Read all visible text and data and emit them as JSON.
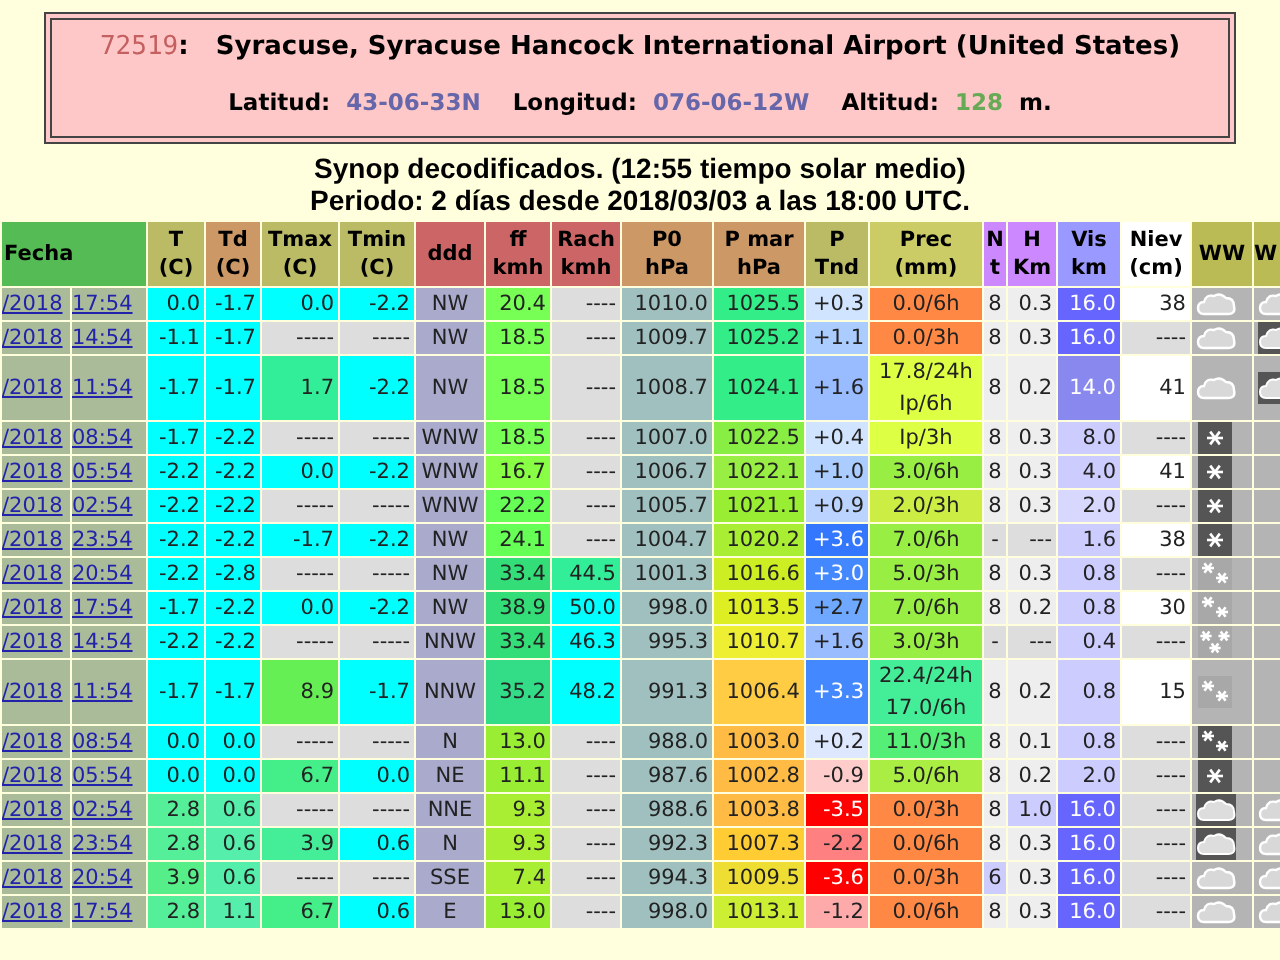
{
  "station": {
    "id": "72519",
    "separator": ":",
    "name": "Syracuse, Syracuse Hancock International Airport (United States)",
    "fields": [
      {
        "label": "Latitud:",
        "value": "43-06-33N",
        "color": "#6666aa"
      },
      {
        "label": "Longitud:",
        "value": "076-06-12W",
        "color": "#6666aa"
      },
      {
        "label": "Altitud:",
        "value": "128",
        "unit": "m.",
        "color": "#66aa55"
      }
    ]
  },
  "subtitle": "Synop decodificados. (12:55 tiempo solar medio)",
  "period": "Periodo: 2 días desde 2018/03/03 a las 18:00 UTC.",
  "columns": [
    {
      "label": "Fecha",
      "color": "#55bb55"
    },
    {
      "label": "T\n(C)",
      "color": "#bbbb66"
    },
    {
      "label": "Td\n(C)",
      "color": "#cc9966"
    },
    {
      "label": "Tmax\n(C)",
      "color": "#bbbb66"
    },
    {
      "label": "Tmin\n(C)",
      "color": "#bbbb66"
    },
    {
      "label": "ddd",
      "color": "#cc6666"
    },
    {
      "label": "ff\nkmh",
      "color": "#cc6666"
    },
    {
      "label": "Rach\nkmh",
      "color": "#cc6666"
    },
    {
      "label": "P0\nhPa",
      "color": "#cc9966"
    },
    {
      "label": "P mar\nhPa",
      "color": "#cc9966"
    },
    {
      "label": "P\nTnd",
      "color": "#bbbb66"
    },
    {
      "label": "Prec\n(mm)",
      "color": "#cccc66"
    },
    {
      "label": "N\nt",
      "color": "#cc88ff"
    },
    {
      "label": "H\nKm",
      "color": "#cc88ff"
    },
    {
      "label": "Vis\nkm",
      "color": "#9999ff"
    },
    {
      "label": "Niev\n(cm)",
      "color": "#ffffff"
    },
    {
      "label": "WW",
      "color": "#bbbb55"
    },
    {
      "label": "W",
      "color": "#bbbb55"
    }
  ],
  "rows": [
    {
      "date": "/2018",
      "time": "17:54",
      "ww": {
        "kind": "cloud"
      },
      "w": {
        "kind": "cloud"
      },
      "cells": [
        {
          "text": "0.0",
          "color": "#00ffff"
        },
        {
          "text": "-1.7",
          "color": "#00ffff"
        },
        {
          "text": "0.0",
          "color": "#00ffff"
        },
        {
          "text": "-2.2",
          "color": "#00ffff"
        },
        {
          "text": "NW",
          "color": "#aaaacc"
        },
        {
          "text": "20.4",
          "color": "#77ff55"
        },
        {
          "text": "----",
          "color": "#dddddd"
        },
        {
          "text": "1010.0",
          "color": "#a0c0c0"
        },
        {
          "text": "1025.5",
          "color": "#33ee88"
        },
        {
          "text": "+0.3",
          "color": "#d0e4ff"
        },
        {
          "text": "0.0/6h",
          "color": "#ff8844"
        },
        {
          "text": "8",
          "color": "#eeeeee"
        },
        {
          "text": "0.3",
          "color": "#eeeeee"
        },
        {
          "text": "16.0",
          "color": "#6666ff"
        },
        {
          "text": "38",
          "color": "#ffffff"
        }
      ]
    },
    {
      "date": "/2018",
      "time": "14:54",
      "ww": {
        "kind": "cloud"
      },
      "w": {
        "kind": "cloud_dark"
      },
      "cells": [
        {
          "text": "-1.1",
          "color": "#00ffff"
        },
        {
          "text": "-1.7",
          "color": "#00ffff"
        },
        {
          "text": "-----",
          "color": "#dddddd"
        },
        {
          "text": "-----",
          "color": "#dddddd"
        },
        {
          "text": "NW",
          "color": "#aaaacc"
        },
        {
          "text": "18.5",
          "color": "#77ff55"
        },
        {
          "text": "----",
          "color": "#dddddd"
        },
        {
          "text": "1009.7",
          "color": "#a0c0c0"
        },
        {
          "text": "1025.2",
          "color": "#33ee88"
        },
        {
          "text": "+1.1",
          "color": "#aaccff"
        },
        {
          "text": "0.0/3h",
          "color": "#ff8844"
        },
        {
          "text": "8",
          "color": "#eeeeee"
        },
        {
          "text": "0.3",
          "color": "#eeeeee"
        },
        {
          "text": "16.0",
          "color": "#6666ff"
        },
        {
          "text": "----",
          "color": "#dddddd"
        }
      ]
    },
    {
      "date": "/2018",
      "time": "11:54",
      "ww": {
        "kind": "cloud"
      },
      "w": {
        "kind": "cloud_dark"
      },
      "cells": [
        {
          "text": "-1.7",
          "color": "#00ffff"
        },
        {
          "text": "-1.7",
          "color": "#00ffff"
        },
        {
          "text": "1.7",
          "color": "#33ee99"
        },
        {
          "text": "-2.2",
          "color": "#00ffff"
        },
        {
          "text": "NW",
          "color": "#aaaacc"
        },
        {
          "text": "18.5",
          "color": "#77ff55"
        },
        {
          "text": "----",
          "color": "#dddddd"
        },
        {
          "text": "1008.7",
          "color": "#a0c0c0"
        },
        {
          "text": "1024.1",
          "color": "#33ee88"
        },
        {
          "text": "+1.6",
          "color": "#99bbff"
        },
        {
          "text": "17.8/24h\nIp/6h",
          "color": "#ddff44"
        },
        {
          "text": "8",
          "color": "#eeeeee"
        },
        {
          "text": "0.2",
          "color": "#eeeeee"
        },
        {
          "text": "14.0",
          "color": "#8888ee"
        },
        {
          "text": "41",
          "color": "#ffffff"
        }
      ]
    },
    {
      "date": "/2018",
      "time": "08:54",
      "ww": {
        "kind": "snow"
      },
      "cells": [
        {
          "text": "-1.7",
          "color": "#00ffff"
        },
        {
          "text": "-2.2",
          "color": "#00ffff"
        },
        {
          "text": "-----",
          "color": "#dddddd"
        },
        {
          "text": "-----",
          "color": "#dddddd"
        },
        {
          "text": "WNW",
          "color": "#aaaacc"
        },
        {
          "text": "18.5",
          "color": "#77ff55"
        },
        {
          "text": "----",
          "color": "#dddddd"
        },
        {
          "text": "1007.0",
          "color": "#a0c0c0"
        },
        {
          "text": "1022.5",
          "color": "#88ee44"
        },
        {
          "text": "+0.4",
          "color": "#d0e4ff"
        },
        {
          "text": "Ip/3h",
          "color": "#ddff44"
        },
        {
          "text": "8",
          "color": "#eeeeee"
        },
        {
          "text": "0.3",
          "color": "#eeeeee"
        },
        {
          "text": "8.0",
          "color": "#ccccff"
        },
        {
          "text": "----",
          "color": "#dddddd"
        }
      ]
    },
    {
      "date": "/2018",
      "time": "05:54",
      "ww": {
        "kind": "snow"
      },
      "cells": [
        {
          "text": "-2.2",
          "color": "#00ffff"
        },
        {
          "text": "-2.2",
          "color": "#00ffff"
        },
        {
          "text": "0.0",
          "color": "#00ffff"
        },
        {
          "text": "-2.2",
          "color": "#00ffff"
        },
        {
          "text": "WNW",
          "color": "#aaaacc"
        },
        {
          "text": "16.7",
          "color": "#88ff44"
        },
        {
          "text": "----",
          "color": "#dddddd"
        },
        {
          "text": "1006.7",
          "color": "#a0c0c0"
        },
        {
          "text": "1022.1",
          "color": "#99ee44"
        },
        {
          "text": "+1.0",
          "color": "#aaccff"
        },
        {
          "text": "3.0/6h",
          "color": "#99ee44"
        },
        {
          "text": "8",
          "color": "#eeeeee"
        },
        {
          "text": "0.3",
          "color": "#eeeeee"
        },
        {
          "text": "4.0",
          "color": "#ccccff"
        },
        {
          "text": "41",
          "color": "#ffffff"
        }
      ]
    },
    {
      "date": "/2018",
      "time": "02:54",
      "ww": {
        "kind": "snow"
      },
      "cells": [
        {
          "text": "-2.2",
          "color": "#00ffff"
        },
        {
          "text": "-2.2",
          "color": "#00ffff"
        },
        {
          "text": "-----",
          "color": "#dddddd"
        },
        {
          "text": "-----",
          "color": "#dddddd"
        },
        {
          "text": "WNW",
          "color": "#aaaacc"
        },
        {
          "text": "22.2",
          "color": "#66ff55"
        },
        {
          "text": "----",
          "color": "#dddddd"
        },
        {
          "text": "1005.7",
          "color": "#a0c0c0"
        },
        {
          "text": "1021.1",
          "color": "#99ee33"
        },
        {
          "text": "+0.9",
          "color": "#bbd4ff"
        },
        {
          "text": "2.0/3h",
          "color": "#ccee44"
        },
        {
          "text": "8",
          "color": "#eeeeee"
        },
        {
          "text": "0.3",
          "color": "#eeeeee"
        },
        {
          "text": "2.0",
          "color": "#d8d8ff"
        },
        {
          "text": "----",
          "color": "#dddddd"
        }
      ]
    },
    {
      "date": "/2018",
      "time": "23:54",
      "ww": {
        "kind": "snow"
      },
      "cells": [
        {
          "text": "-2.2",
          "color": "#00ffff"
        },
        {
          "text": "-2.2",
          "color": "#00ffff"
        },
        {
          "text": "-1.7",
          "color": "#00ffff"
        },
        {
          "text": "-2.2",
          "color": "#00ffff"
        },
        {
          "text": "NW",
          "color": "#aaaacc"
        },
        {
          "text": "24.1",
          "color": "#66ff55"
        },
        {
          "text": "----",
          "color": "#dddddd"
        },
        {
          "text": "1004.7",
          "color": "#a0c0c0"
        },
        {
          "text": "1020.2",
          "color": "#aaee33"
        },
        {
          "text": "+3.6",
          "color": "#3377ff"
        },
        {
          "text": "7.0/6h",
          "color": "#99ee44"
        },
        {
          "text": "-",
          "color": "#dddddd"
        },
        {
          "text": "---",
          "color": "#dddddd"
        },
        {
          "text": "1.6",
          "color": "#ccccff"
        },
        {
          "text": "38",
          "color": "#ffffff"
        }
      ]
    },
    {
      "date": "/2018",
      "time": "20:54",
      "ww": {
        "kind": "snow_pair"
      },
      "cells": [
        {
          "text": "-2.2",
          "color": "#00ffff"
        },
        {
          "text": "-2.8",
          "color": "#00ffff"
        },
        {
          "text": "-----",
          "color": "#dddddd"
        },
        {
          "text": "-----",
          "color": "#dddddd"
        },
        {
          "text": "NW",
          "color": "#aaaacc"
        },
        {
          "text": "33.4",
          "color": "#33dd77"
        },
        {
          "text": "44.5",
          "color": "#33ee99"
        },
        {
          "text": "1001.3",
          "color": "#a0c0c0"
        },
        {
          "text": "1016.6",
          "color": "#ccee22"
        },
        {
          "text": "+3.0",
          "color": "#4488ff"
        },
        {
          "text": "5.0/3h",
          "color": "#99ee44"
        },
        {
          "text": "8",
          "color": "#eeeeee"
        },
        {
          "text": "0.3",
          "color": "#eeeeee"
        },
        {
          "text": "0.8",
          "color": "#ccccff"
        },
        {
          "text": "----",
          "color": "#dddddd"
        }
      ]
    },
    {
      "date": "/2018",
      "time": "17:54",
      "ww": {
        "kind": "snow_pair"
      },
      "cells": [
        {
          "text": "-1.7",
          "color": "#00ffff"
        },
        {
          "text": "-2.2",
          "color": "#00ffff"
        },
        {
          "text": "0.0",
          "color": "#00ffff"
        },
        {
          "text": "-2.2",
          "color": "#00ffff"
        },
        {
          "text": "NW",
          "color": "#aaaacc"
        },
        {
          "text": "38.9",
          "color": "#33dd77"
        },
        {
          "text": "50.0",
          "color": "#00ffff"
        },
        {
          "text": "998.0",
          "color": "#a0c0c0"
        },
        {
          "text": "1013.5",
          "color": "#ddee22"
        },
        {
          "text": "+2.7",
          "color": "#6fa8ff"
        },
        {
          "text": "7.0/6h",
          "color": "#99ee44"
        },
        {
          "text": "8",
          "color": "#eeeeee"
        },
        {
          "text": "0.2",
          "color": "#eeeeee"
        },
        {
          "text": "0.8",
          "color": "#ccccff"
        },
        {
          "text": "30",
          "color": "#ffffff"
        }
      ]
    },
    {
      "date": "/2018",
      "time": "14:54",
      "ww": {
        "kind": "snow_three"
      },
      "cells": [
        {
          "text": "-2.2",
          "color": "#00ffff"
        },
        {
          "text": "-2.2",
          "color": "#00ffff"
        },
        {
          "text": "-----",
          "color": "#dddddd"
        },
        {
          "text": "-----",
          "color": "#dddddd"
        },
        {
          "text": "NNW",
          "color": "#aaaacc"
        },
        {
          "text": "33.4",
          "color": "#33dd77"
        },
        {
          "text": "46.3",
          "color": "#00ffff"
        },
        {
          "text": "995.3",
          "color": "#a0c0c0"
        },
        {
          "text": "1010.7",
          "color": "#eeee33"
        },
        {
          "text": "+1.6",
          "color": "#99bbff"
        },
        {
          "text": "3.0/3h",
          "color": "#99ee44"
        },
        {
          "text": "-",
          "color": "#dddddd"
        },
        {
          "text": "---",
          "color": "#dddddd"
        },
        {
          "text": "0.4",
          "color": "#ccccff"
        },
        {
          "text": "----",
          "color": "#dddddd"
        }
      ]
    },
    {
      "date": "/2018",
      "time": "11:54",
      "ww": {
        "kind": "snow_pair"
      },
      "cells": [
        {
          "text": "-1.7",
          "color": "#00ffff"
        },
        {
          "text": "-1.7",
          "color": "#00ffff"
        },
        {
          "text": "8.9",
          "color": "#66ee55"
        },
        {
          "text": "-1.7",
          "color": "#00ffff"
        },
        {
          "text": "NNW",
          "color": "#aaaacc"
        },
        {
          "text": "35.2",
          "color": "#33dd88"
        },
        {
          "text": "48.2",
          "color": "#00ffff"
        },
        {
          "text": "991.3",
          "color": "#a0c0c0"
        },
        {
          "text": "1006.4",
          "color": "#ffcc44"
        },
        {
          "text": "+3.3",
          "color": "#4488ff"
        },
        {
          "text": "22.4/24h\n17.0/6h",
          "color": "#44ee99"
        },
        {
          "text": "8",
          "color": "#eeeeee"
        },
        {
          "text": "0.2",
          "color": "#eeeeee"
        },
        {
          "text": "0.8",
          "color": "#ccccff"
        },
        {
          "text": "15",
          "color": "#ffffff"
        }
      ]
    },
    {
      "date": "/2018",
      "time": "08:54",
      "ww": {
        "kind": "snow_pair_dark"
      },
      "cells": [
        {
          "text": "0.0",
          "color": "#00ffff"
        },
        {
          "text": "0.0",
          "color": "#00ffff"
        },
        {
          "text": "-----",
          "color": "#dddddd"
        },
        {
          "text": "-----",
          "color": "#dddddd"
        },
        {
          "text": "N",
          "color": "#aaaacc"
        },
        {
          "text": "13.0",
          "color": "#99ee33"
        },
        {
          "text": "----",
          "color": "#dddddd"
        },
        {
          "text": "988.0",
          "color": "#a0c0c0"
        },
        {
          "text": "1003.0",
          "color": "#ffbb44"
        },
        {
          "text": "+0.2",
          "color": "#dde8ff"
        },
        {
          "text": "11.0/3h",
          "color": "#55ee77"
        },
        {
          "text": "8",
          "color": "#eeeeee"
        },
        {
          "text": "0.1",
          "color": "#eeeeee"
        },
        {
          "text": "0.8",
          "color": "#ccccff"
        },
        {
          "text": "----",
          "color": "#dddddd"
        }
      ]
    },
    {
      "date": "/2018",
      "time": "05:54",
      "ww": {
        "kind": "snow"
      },
      "cells": [
        {
          "text": "0.0",
          "color": "#00ffff"
        },
        {
          "text": "0.0",
          "color": "#00ffff"
        },
        {
          "text": "6.7",
          "color": "#44ee88"
        },
        {
          "text": "0.0",
          "color": "#00ffff"
        },
        {
          "text": "NE",
          "color": "#aaaacc"
        },
        {
          "text": "11.1",
          "color": "#99ee33"
        },
        {
          "text": "----",
          "color": "#dddddd"
        },
        {
          "text": "987.6",
          "color": "#a0c0c0"
        },
        {
          "text": "1002.8",
          "color": "#ffbb44"
        },
        {
          "text": "-0.9",
          "color": "#ffcccc"
        },
        {
          "text": "5.0/6h",
          "color": "#aaee44"
        },
        {
          "text": "8",
          "color": "#eeeeee"
        },
        {
          "text": "0.2",
          "color": "#eeeeee"
        },
        {
          "text": "2.0",
          "color": "#ccccff"
        },
        {
          "text": "----",
          "color": "#dddddd"
        }
      ]
    },
    {
      "date": "/2018",
      "time": "02:54",
      "ww": {
        "kind": "cloud_dark"
      },
      "w": {
        "kind": "cloud"
      },
      "cells": [
        {
          "text": "2.8",
          "color": "#55ee99"
        },
        {
          "text": "0.6",
          "color": "#55eeaa"
        },
        {
          "text": "-----",
          "color": "#dddddd"
        },
        {
          "text": "-----",
          "color": "#dddddd"
        },
        {
          "text": "NNE",
          "color": "#aaaacc"
        },
        {
          "text": "9.3",
          "color": "#aaee33"
        },
        {
          "text": "----",
          "color": "#dddddd"
        },
        {
          "text": "988.6",
          "color": "#a0c0c0"
        },
        {
          "text": "1003.8",
          "color": "#ffbb44"
        },
        {
          "text": "-3.5",
          "color": "#ff0000"
        },
        {
          "text": "0.0/3h",
          "color": "#ff8844"
        },
        {
          "text": "8",
          "color": "#eeeeee"
        },
        {
          "text": "1.0",
          "color": "#ccccff"
        },
        {
          "text": "16.0",
          "color": "#6666ff"
        },
        {
          "text": "----",
          "color": "#dddddd"
        }
      ]
    },
    {
      "date": "/2018",
      "time": "23:54",
      "ww": {
        "kind": "cloud_dark"
      },
      "w": {
        "kind": "cloud"
      },
      "cells": [
        {
          "text": "2.8",
          "color": "#55ee99"
        },
        {
          "text": "0.6",
          "color": "#55eeaa"
        },
        {
          "text": "3.9",
          "color": "#44ee99"
        },
        {
          "text": "0.6",
          "color": "#00ffff"
        },
        {
          "text": "N",
          "color": "#aaaacc"
        },
        {
          "text": "9.3",
          "color": "#aaee33"
        },
        {
          "text": "----",
          "color": "#dddddd"
        },
        {
          "text": "992.3",
          "color": "#a0c0c0"
        },
        {
          "text": "1007.3",
          "color": "#ffcc33"
        },
        {
          "text": "-2.2",
          "color": "#ff8080"
        },
        {
          "text": "0.0/6h",
          "color": "#ff8844"
        },
        {
          "text": "8",
          "color": "#eeeeee"
        },
        {
          "text": "0.3",
          "color": "#eeeeee"
        },
        {
          "text": "16.0",
          "color": "#6666ff"
        },
        {
          "text": "----",
          "color": "#dddddd"
        }
      ]
    },
    {
      "date": "/2018",
      "time": "20:54",
      "ww": {
        "kind": "cloud"
      },
      "w": {
        "kind": "cloud"
      },
      "cells": [
        {
          "text": "3.9",
          "color": "#55ee88"
        },
        {
          "text": "0.6",
          "color": "#55eeaa"
        },
        {
          "text": "-----",
          "color": "#dddddd"
        },
        {
          "text": "-----",
          "color": "#dddddd"
        },
        {
          "text": "SSE",
          "color": "#aaaacc"
        },
        {
          "text": "7.4",
          "color": "#aaee33"
        },
        {
          "text": "----",
          "color": "#dddddd"
        },
        {
          "text": "994.3",
          "color": "#a0c0c0"
        },
        {
          "text": "1009.5",
          "color": "#eedd33"
        },
        {
          "text": "-3.6",
          "color": "#ff0000"
        },
        {
          "text": "0.0/3h",
          "color": "#ff8844"
        },
        {
          "text": "6",
          "color": "#ccccff"
        },
        {
          "text": "0.3",
          "color": "#eeeeee"
        },
        {
          "text": "16.0",
          "color": "#6666ff"
        },
        {
          "text": "----",
          "color": "#dddddd"
        }
      ]
    },
    {
      "date": "/2018",
      "time": "17:54",
      "ww": {
        "kind": "cloud"
      },
      "w": {
        "kind": "cloud"
      },
      "cells": [
        {
          "text": "2.8",
          "color": "#55ee99"
        },
        {
          "text": "1.1",
          "color": "#55eeaa"
        },
        {
          "text": "6.7",
          "color": "#44ee88"
        },
        {
          "text": "0.6",
          "color": "#00ffff"
        },
        {
          "text": "E",
          "color": "#aaaacc"
        },
        {
          "text": "13.0",
          "color": "#99ee33"
        },
        {
          "text": "----",
          "color": "#dddddd"
        },
        {
          "text": "998.0",
          "color": "#a0c0c0"
        },
        {
          "text": "1013.1",
          "color": "#ccee33"
        },
        {
          "text": "-1.2",
          "color": "#ffaaaa"
        },
        {
          "text": "0.0/6h",
          "color": "#ff8844"
        },
        {
          "text": "8",
          "color": "#eeeeee"
        },
        {
          "text": "0.3",
          "color": "#eeeeee"
        },
        {
          "text": "16.0",
          "color": "#6666ff"
        },
        {
          "text": "----",
          "color": "#dddddd"
        }
      ]
    }
  ]
}
